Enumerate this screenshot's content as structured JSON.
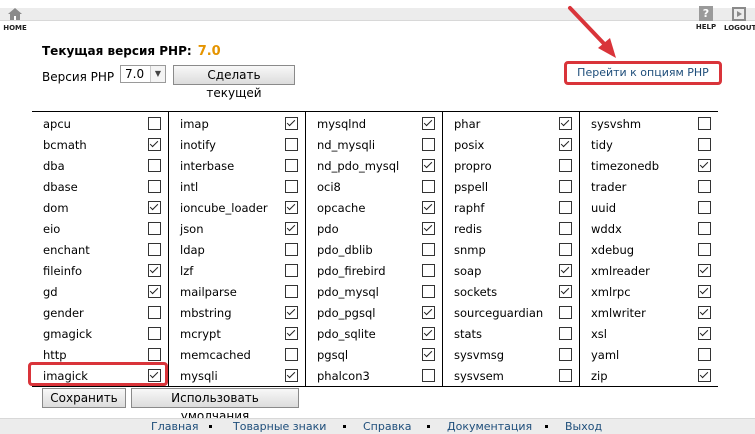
{
  "nav": {
    "home_label": "HOME",
    "help_label": "HELP",
    "help_glyph": "?",
    "logout_label": "LOGOUT"
  },
  "version": {
    "title": "Текущая версия PHP:",
    "current": "7.0",
    "label": "Версия PHP",
    "selected": "7.0",
    "make_current_button": "Сделать текущей"
  },
  "options_link": "Перейти к опциям PHP",
  "extensions": {
    "columns": [
      [
        {
          "name": "apcu",
          "checked": false
        },
        {
          "name": "bcmath",
          "checked": true
        },
        {
          "name": "dba",
          "checked": false
        },
        {
          "name": "dbase",
          "checked": false
        },
        {
          "name": "dom",
          "checked": true
        },
        {
          "name": "eio",
          "checked": false
        },
        {
          "name": "enchant",
          "checked": false
        },
        {
          "name": "fileinfo",
          "checked": true
        },
        {
          "name": "gd",
          "checked": true
        },
        {
          "name": "gender",
          "checked": false
        },
        {
          "name": "gmagick",
          "checked": false
        },
        {
          "name": "http",
          "checked": false
        },
        {
          "name": "imagick",
          "checked": true
        }
      ],
      [
        {
          "name": "imap",
          "checked": true
        },
        {
          "name": "inotify",
          "checked": false
        },
        {
          "name": "interbase",
          "checked": false
        },
        {
          "name": "intl",
          "checked": false
        },
        {
          "name": "ioncube_loader",
          "checked": true
        },
        {
          "name": "json",
          "checked": true
        },
        {
          "name": "ldap",
          "checked": false
        },
        {
          "name": "lzf",
          "checked": false
        },
        {
          "name": "mailparse",
          "checked": false
        },
        {
          "name": "mbstring",
          "checked": true
        },
        {
          "name": "mcrypt",
          "checked": true
        },
        {
          "name": "memcached",
          "checked": false
        },
        {
          "name": "mysqli",
          "checked": true
        }
      ],
      [
        {
          "name": "mysqlnd",
          "checked": true
        },
        {
          "name": "nd_mysqli",
          "checked": false
        },
        {
          "name": "nd_pdo_mysql",
          "checked": true
        },
        {
          "name": "oci8",
          "checked": false
        },
        {
          "name": "opcache",
          "checked": true
        },
        {
          "name": "pdo",
          "checked": true
        },
        {
          "name": "pdo_dblib",
          "checked": false
        },
        {
          "name": "pdo_firebird",
          "checked": false
        },
        {
          "name": "pdo_mysql",
          "checked": false
        },
        {
          "name": "pdo_pgsql",
          "checked": true
        },
        {
          "name": "pdo_sqlite",
          "checked": true
        },
        {
          "name": "pgsql",
          "checked": true
        },
        {
          "name": "phalcon3",
          "checked": false
        }
      ],
      [
        {
          "name": "phar",
          "checked": true
        },
        {
          "name": "posix",
          "checked": true
        },
        {
          "name": "propro",
          "checked": false
        },
        {
          "name": "pspell",
          "checked": false
        },
        {
          "name": "raphf",
          "checked": false
        },
        {
          "name": "redis",
          "checked": false
        },
        {
          "name": "snmp",
          "checked": false
        },
        {
          "name": "soap",
          "checked": true
        },
        {
          "name": "sockets",
          "checked": true
        },
        {
          "name": "sourceguardian",
          "checked": false
        },
        {
          "name": "stats",
          "checked": false
        },
        {
          "name": "sysvmsg",
          "checked": false
        },
        {
          "name": "sysvsem",
          "checked": false
        }
      ],
      [
        {
          "name": "sysvshm",
          "checked": false
        },
        {
          "name": "tidy",
          "checked": false
        },
        {
          "name": "timezonedb",
          "checked": true
        },
        {
          "name": "trader",
          "checked": false
        },
        {
          "name": "uuid",
          "checked": false
        },
        {
          "name": "wddx",
          "checked": false
        },
        {
          "name": "xdebug",
          "checked": false
        },
        {
          "name": "xmlreader",
          "checked": true
        },
        {
          "name": "xmlrpc",
          "checked": true
        },
        {
          "name": "xmlwriter",
          "checked": true
        },
        {
          "name": "xsl",
          "checked": true
        },
        {
          "name": "yaml",
          "checked": false
        },
        {
          "name": "zip",
          "checked": true
        }
      ]
    ]
  },
  "actions": {
    "save": "Сохранить",
    "use_defaults": "Использовать умолчания"
  },
  "footer": {
    "links": [
      "Главная",
      "Товарные знаки",
      "Справка",
      "Документация",
      "Выход"
    ]
  },
  "colors": {
    "version_accent": "#e59400",
    "highlight": "#d9343a",
    "link": "#1d4d7a"
  }
}
